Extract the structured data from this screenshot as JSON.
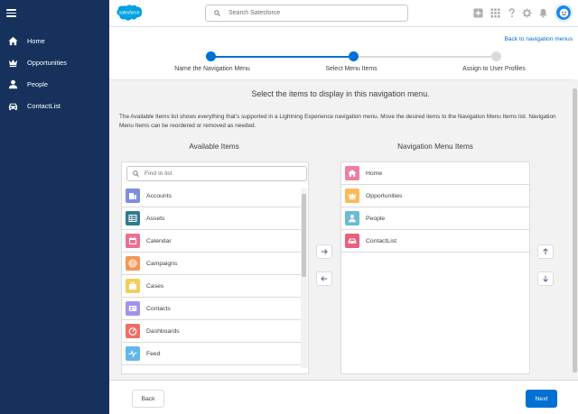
{
  "sidebar": {
    "items": [
      {
        "label": "Home",
        "icon": "home-icon"
      },
      {
        "label": "Opportunities",
        "icon": "crown-icon"
      },
      {
        "label": "People",
        "icon": "person-icon"
      },
      {
        "label": "ContactList",
        "icon": "car-icon"
      }
    ]
  },
  "header": {
    "logo_text": "salesforce",
    "search_placeholder": "Search Salesforce"
  },
  "wizard": {
    "back_link": "Back to navigation menus",
    "steps": [
      "Name the Navigation Menu",
      "Select Menu Items",
      "Assign to User Profiles"
    ],
    "heading": "Select the items to display in this navigation menu.",
    "description": "The Available Items list shows everything that’s supported in a Lightning Experience navigation menu. Move the desired items to the Navigation Menu Items list. Navigation Menu Items can be reordered or removed as needed.",
    "available_title": "Available Items",
    "selected_title": "Navigation Menu Items",
    "find_placeholder": "Find in list",
    "available_items": [
      {
        "label": "Accounts",
        "color": "#7f8de1"
      },
      {
        "label": "Assets",
        "color": "#317a92"
      },
      {
        "label": "Calendar",
        "color": "#eb7092"
      },
      {
        "label": "Campaigns",
        "color": "#f49756"
      },
      {
        "label": "Cases",
        "color": "#f2cf5b"
      },
      {
        "label": "Contacts",
        "color": "#a094ed"
      },
      {
        "label": "Dashboards",
        "color": "#ef6e64"
      },
      {
        "label": "Feed",
        "color": "#62b7ed"
      }
    ],
    "selected_items": [
      {
        "label": "Home",
        "color": "#ef7ea0"
      },
      {
        "label": "Opportunities",
        "color": "#fcb95b"
      },
      {
        "label": "People",
        "color": "#6bbbd6"
      },
      {
        "label": "ContactList",
        "color": "#e8607a"
      }
    ],
    "back_button": "Back",
    "next_button": "Next"
  }
}
